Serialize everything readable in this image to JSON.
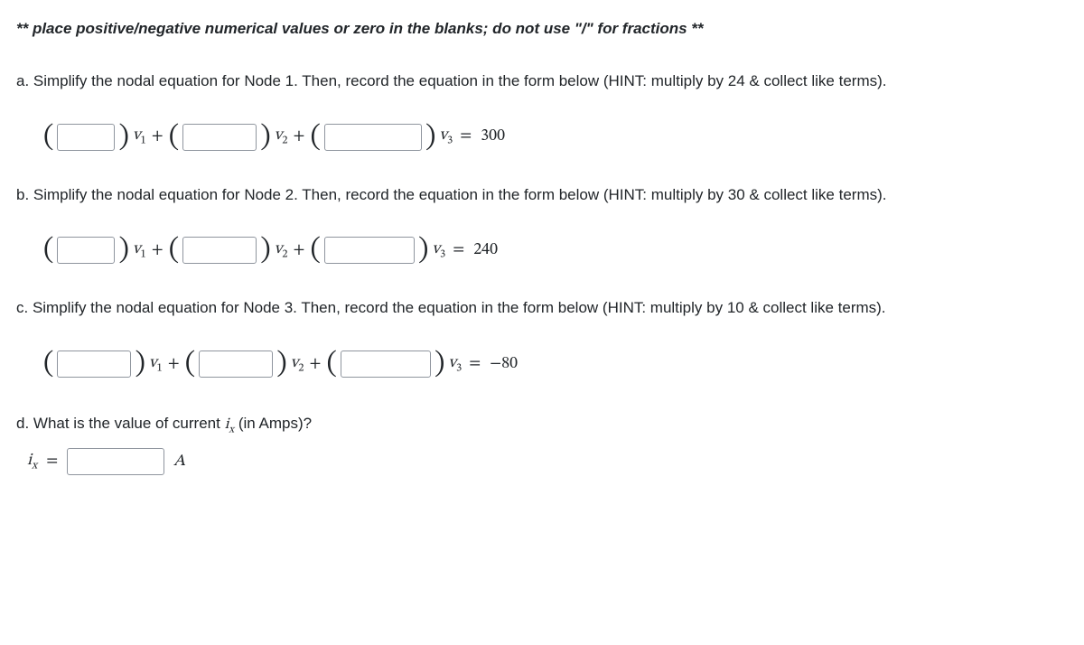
{
  "instruction": "** place positive/negative numerical values or zero in the blanks; do not use \"/\" for fractions **",
  "parts": {
    "a": {
      "prompt": "a. Simplify the nodal equation for Node 1. Then, record the equation in the form below (HINT: multiply by 24 & collect like terms).",
      "rhs": "300"
    },
    "b": {
      "prompt": "b. Simplify the nodal equation for Node 2. Then, record the equation in the form below (HINT: multiply by 30 & collect like terms).",
      "rhs": "240"
    },
    "c": {
      "prompt": "c. Simplify the nodal equation for Node 3. Then, record the equation in the form below (HINT: multiply by 10 & collect like terms).",
      "rhs": "−80"
    },
    "d": {
      "prompt": "d. What is the value of current "
    }
  },
  "sym": {
    "v": "v",
    "i": "i",
    "x": "x",
    "s1": "1",
    "s2": "2",
    "s3": "3",
    "plus": "+",
    "eq": "=",
    "A": "A",
    "amps_suffix": " (in Amps)?"
  }
}
